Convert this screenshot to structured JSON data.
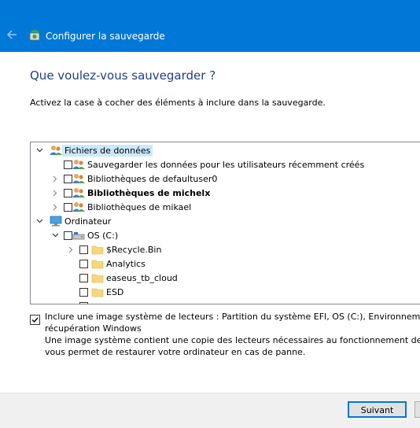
{
  "window": {
    "title": "Configurer la sauvegarde"
  },
  "heading": "Que voulez-vous sauvegarder ?",
  "instruction": "Activez la case à cocher des éléments à inclure dans la sauvegarde.",
  "tree": {
    "data_files": {
      "label": "Fichiers de données",
      "items": [
        {
          "label": "Sauvegarder les données pour les utilisateurs récemment créés"
        },
        {
          "label": "Bibliothèques de defaultuser0"
        },
        {
          "label": "Bibliothèques de michelx"
        },
        {
          "label": "Bibliothèques de mikael"
        }
      ]
    },
    "computer": {
      "label": "Ordinateur",
      "drive": {
        "label": "OS (C:)"
      },
      "folders": [
        {
          "label": "$Recycle.Bin"
        },
        {
          "label": "Analytics"
        },
        {
          "label": "easeus_tb_cloud"
        },
        {
          "label": "ESD"
        }
      ]
    }
  },
  "system_image": {
    "checked": true,
    "label_line1": "Inclure une image système de lecteurs : Partition du système EFI, OS (C:), Environnement de",
    "label_line2": "récupération Windows",
    "desc_line1": "Une image système contient une copie des lecteurs nécessaires au fonctionnement de Windows. Elle",
    "desc_line2": "vous permet de restaurer votre ordinateur en cas de panne."
  },
  "buttons": {
    "next": "Suivant"
  },
  "colors": {
    "titlebar": "#0078d7",
    "heading": "#1e3f8b",
    "selection": "#cce8ff"
  }
}
